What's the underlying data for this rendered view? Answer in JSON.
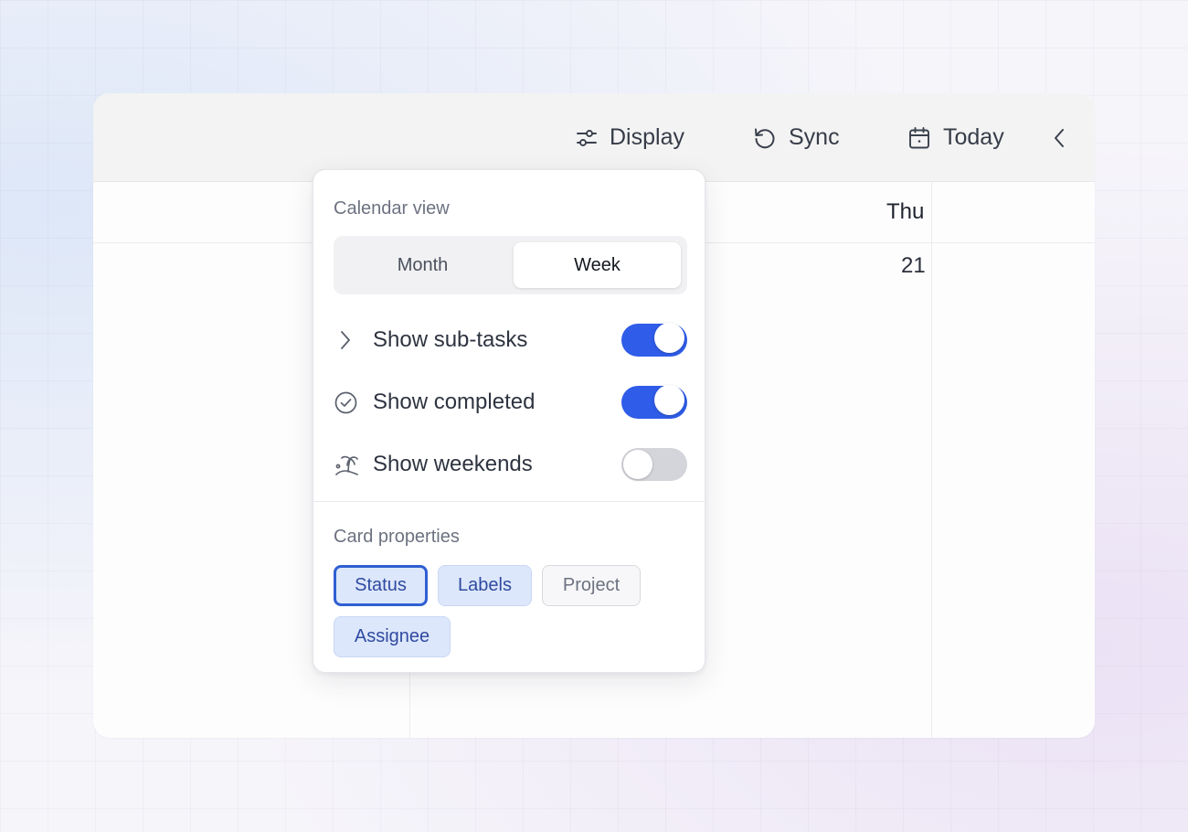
{
  "toolbar": {
    "display_label": "Display",
    "sync_label": "Sync",
    "today_label": "Today"
  },
  "calendar": {
    "day_name": "Thu",
    "day_number": "21"
  },
  "display_popover": {
    "view_section_label": "Calendar view",
    "view_options": [
      {
        "label": "Month",
        "selected": false
      },
      {
        "label": "Week",
        "selected": true
      }
    ],
    "toggles": [
      {
        "label": "Show sub-tasks",
        "icon": "chevron-right-icon",
        "on": true
      },
      {
        "label": "Show completed",
        "icon": "check-circle-icon",
        "on": true
      },
      {
        "label": "Show weekends",
        "icon": "island-icon",
        "on": false
      }
    ],
    "properties_section_label": "Card properties",
    "properties": [
      {
        "label": "Status",
        "selected": true,
        "focused": true
      },
      {
        "label": "Labels",
        "selected": true
      },
      {
        "label": "Project",
        "selected": false
      },
      {
        "label": "Assignee",
        "selected": true
      }
    ]
  },
  "colors": {
    "accent": "#2f5ce8",
    "chip_selected_bg": "#dde7fb",
    "toggle_off": "#d4d5da"
  }
}
